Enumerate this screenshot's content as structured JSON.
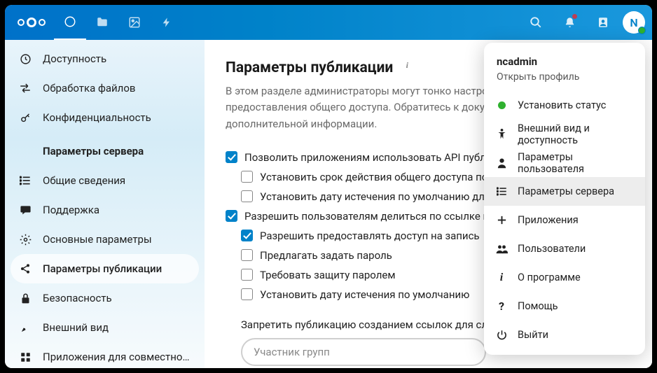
{
  "topbar": {
    "avatar_initial": "N"
  },
  "sidebar": {
    "personal": [
      {
        "label": "Доступность",
        "icon": "eye"
      },
      {
        "label": "Обработка файлов",
        "icon": "files-arrows"
      },
      {
        "label": "Конфиденциальность",
        "icon": "key"
      }
    ],
    "admin_heading": "Параметры сервера",
    "admin": [
      {
        "label": "Общие сведения",
        "icon": "list"
      },
      {
        "label": "Поддержка",
        "icon": "chat"
      },
      {
        "label": "Основные параметры",
        "icon": "gear"
      },
      {
        "label": "Параметры публикации",
        "icon": "share",
        "active": true
      },
      {
        "label": "Безопасность",
        "icon": "lock"
      },
      {
        "label": "Внешний вид",
        "icon": "theme"
      },
      {
        "label": "Приложения для совместной …",
        "icon": "apps"
      }
    ]
  },
  "main": {
    "title": "Параметры публикации",
    "description": "В этом разделе администраторы могут тонко настроить поведение предоставления общего доступа. Обратитесь к документации для получения дополнительной информации.",
    "options": [
      {
        "level": 1,
        "checked": true,
        "label": "Позволить приложениям использовать API публикации"
      },
      {
        "level": 2,
        "checked": false,
        "label": "Установить срок действия общего доступа по умолчанию"
      },
      {
        "level": 2,
        "checked": false,
        "label": "Установить дату истечения по умолчанию для общих ресурсов"
      },
      {
        "level": 1,
        "checked": true,
        "label": "Разрешить пользователям делиться по ссылке и по электронной почте"
      },
      {
        "level": 3,
        "checked": true,
        "label": "Разрешить предоставлять доступ на запись"
      },
      {
        "level": 3,
        "checked": false,
        "label": "Предлагать задать пароль"
      },
      {
        "level": 3,
        "checked": false,
        "label": "Требовать защиту паролем"
      },
      {
        "level": 3,
        "checked": false,
        "label": "Установить дату истечения по умолчанию"
      }
    ],
    "exclude_label": "Запретить публикацию созданием ссылок для следующих групп",
    "exclude_placeholder": "Участник групп"
  },
  "usermenu": {
    "name": "ncadmin",
    "open_profile": "Открыть профиль",
    "items": [
      {
        "label": "Установить статус",
        "icon": "status"
      },
      {
        "label": "Внешний вид и доступность",
        "icon": "accessibility"
      },
      {
        "label": "Параметры пользователя",
        "icon": "person"
      },
      {
        "label": "Параметры сервера",
        "icon": "server-list",
        "active": true
      },
      {
        "label": "Приложения",
        "icon": "plus"
      },
      {
        "label": "Пользователи",
        "icon": "users"
      },
      {
        "label": "О программе",
        "icon": "info"
      },
      {
        "label": "Помощь",
        "icon": "help"
      },
      {
        "label": "Выйти",
        "icon": "power"
      }
    ]
  }
}
